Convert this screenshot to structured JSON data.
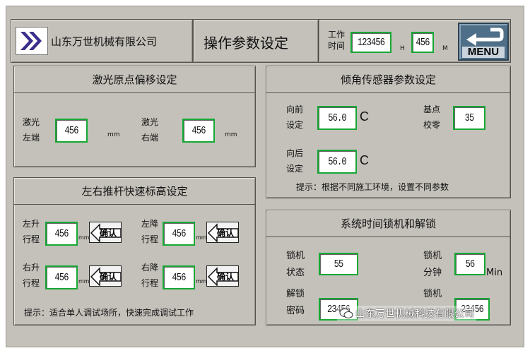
{
  "header": {
    "company": "山东万世机械有限公司",
    "title": "操作参数设定",
    "worktime_label_line1": "工作",
    "worktime_label_line2": "时间",
    "hours_value": "123456",
    "hours_unit": "H",
    "minutes_value": "456",
    "minutes_unit": "M",
    "menu_label": "MENU"
  },
  "laser_panel": {
    "title": "激光原点偏移设定",
    "left": {
      "label_line1": "激光",
      "label_line2": "左端",
      "value": "456",
      "unit": "mm"
    },
    "right": {
      "label_line1": "激光",
      "label_line2": "右端",
      "value": "456",
      "unit": "mm"
    }
  },
  "tilt_panel": {
    "title": "倾角传感器参数设定",
    "forward": {
      "label_line1": "向前",
      "label_line2": "设定",
      "value": "56.0",
      "unit": "C"
    },
    "base": {
      "label_line1": "基点",
      "label_line2": "校零",
      "value": "35"
    },
    "backward": {
      "label_line1": "向后",
      "label_line2": "设定",
      "value": "56.0",
      "unit": "C"
    },
    "hint": "提示：根据不同施工环境，设置不同参数"
  },
  "push_panel": {
    "title": "左右推杆快速标高设定",
    "left_up": {
      "label_line1": "左升",
      "label_line2": "行程",
      "value": "456",
      "unit": "mm"
    },
    "left_down": {
      "label_line1": "左降",
      "label_line2": "行程",
      "value": "456",
      "unit": "mm"
    },
    "right_up": {
      "label_line1": "右升",
      "label_line2": "行程",
      "value": "456",
      "unit": "mm"
    },
    "right_down": {
      "label_line1": "右降",
      "label_line2": "行程",
      "value": "456",
      "unit": "mm"
    },
    "confirm_label": "确认",
    "hint": "提示：适合单人调试场所，快速完成调试工作"
  },
  "lock_panel": {
    "title": "系统时间锁机和解锁",
    "lock_state": {
      "label_line1": "锁机",
      "label_line2": "状态",
      "value": "55"
    },
    "lock_minutes": {
      "label_line1": "锁机",
      "label_line2": "分钟",
      "value": "56",
      "unit": "Min"
    },
    "unlock_code": {
      "label_line1": "解锁",
      "label_line2": "密码",
      "value": "23456"
    },
    "lock_code": {
      "label_line1": "锁机",
      "value": "23456"
    }
  },
  "watermark": "山东万世机械科技有限公司",
  "colors": {
    "screen_bg": "#c4c1ba",
    "field_border": "#15a834",
    "logo_blue": "#3a2f8c",
    "menu_bg": "#4f6f88"
  }
}
